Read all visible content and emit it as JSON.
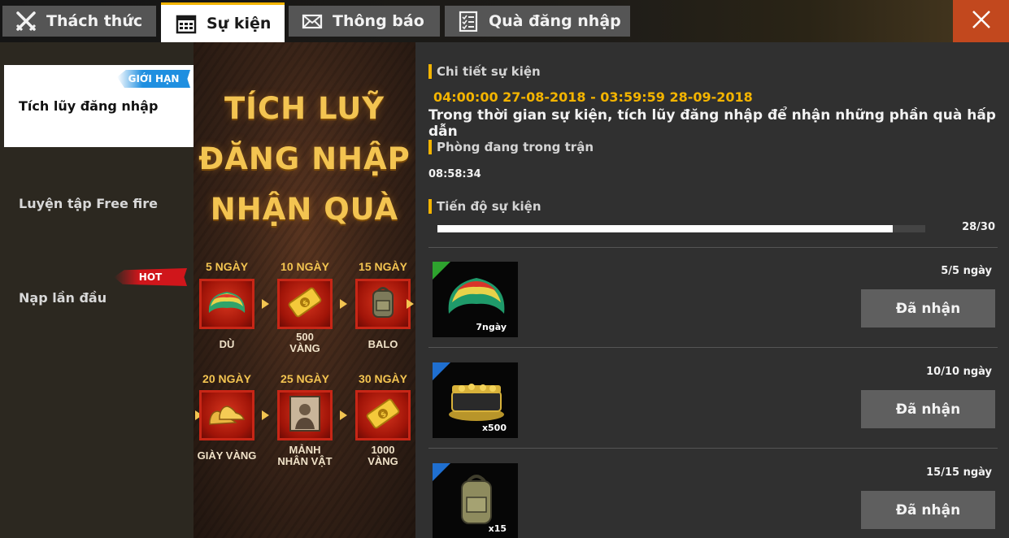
{
  "tabs": [
    {
      "label": "Thách thức",
      "icon": "crossed-swords-icon",
      "active": false
    },
    {
      "label": "Sự kiện",
      "icon": "calendar-icon",
      "active": true
    },
    {
      "label": "Thông báo",
      "icon": "envelope-icon",
      "active": false
    },
    {
      "label": "Quà đăng nhập",
      "icon": "checklist-icon",
      "active": false
    }
  ],
  "close_icon": "close-icon",
  "sidebar": {
    "items": [
      {
        "label": "Tích lũy đăng nhập",
        "badge": "GIỚI HẠN",
        "badge_color": "#1f8fe0",
        "active": true
      },
      {
        "label": "Luyện tập Free fire",
        "badge": "",
        "active": false
      },
      {
        "label": "Nạp lần đầu",
        "badge": "HOT",
        "badge_color": "#d0161b",
        "active": false
      }
    ]
  },
  "banner": {
    "title_lines": [
      "TÍCH LUỸ",
      "ĐĂNG NHẬP",
      "NHẬN QUÀ"
    ],
    "rewards": [
      {
        "day": "5 NGÀY",
        "label": "DÙ",
        "icon": "parachute-icon"
      },
      {
        "day": "10 NGÀY",
        "label": "500\nVÀNG",
        "icon": "gold-ticket-icon"
      },
      {
        "day": "15 NGÀY",
        "label": "BALO",
        "icon": "backpack-icon"
      },
      {
        "day": "20 NGÀY",
        "label": "GIÀY VÀNG",
        "icon": "golden-shoes-icon"
      },
      {
        "day": "25 NGÀY",
        "label": "MẢNH\nNHÂN VẬT",
        "icon": "character-portrait-icon"
      },
      {
        "day": "30 NGÀY",
        "label": "1000\nVÀNG",
        "icon": "gold-ticket-icon"
      }
    ]
  },
  "details": {
    "heading": "Chi tiết sự kiện",
    "date_range": "04:00:00 27-08-2018 -  03:59:59 28-09-2018",
    "description": "Trong thời gian sự kiện, tích lũy đăng nhập để nhận những phần quà hấp dẫn",
    "room_heading": "Phòng đang trong trận",
    "room_time": "08:58:34",
    "progress_heading": "Tiến độ sự kiện",
    "progress_current": 28,
    "progress_total": 30,
    "progress_text": "28/30",
    "accent": "#f3b400"
  },
  "rewards_list": [
    {
      "icon": "parachute-icon",
      "qty": "7ngày",
      "days": "5/5 ngày",
      "button": "Đã nhận",
      "corner_color": "#2ea32e"
    },
    {
      "icon": "gold-chest-icon",
      "qty": "x500",
      "days": "10/10 ngày",
      "button": "Đã nhận",
      "corner_color": "#1f6fd0"
    },
    {
      "icon": "backpack-icon",
      "qty": "x15",
      "days": "15/15 ngày",
      "button": "Đã nhận",
      "corner_color": "#1f6fd0"
    }
  ]
}
